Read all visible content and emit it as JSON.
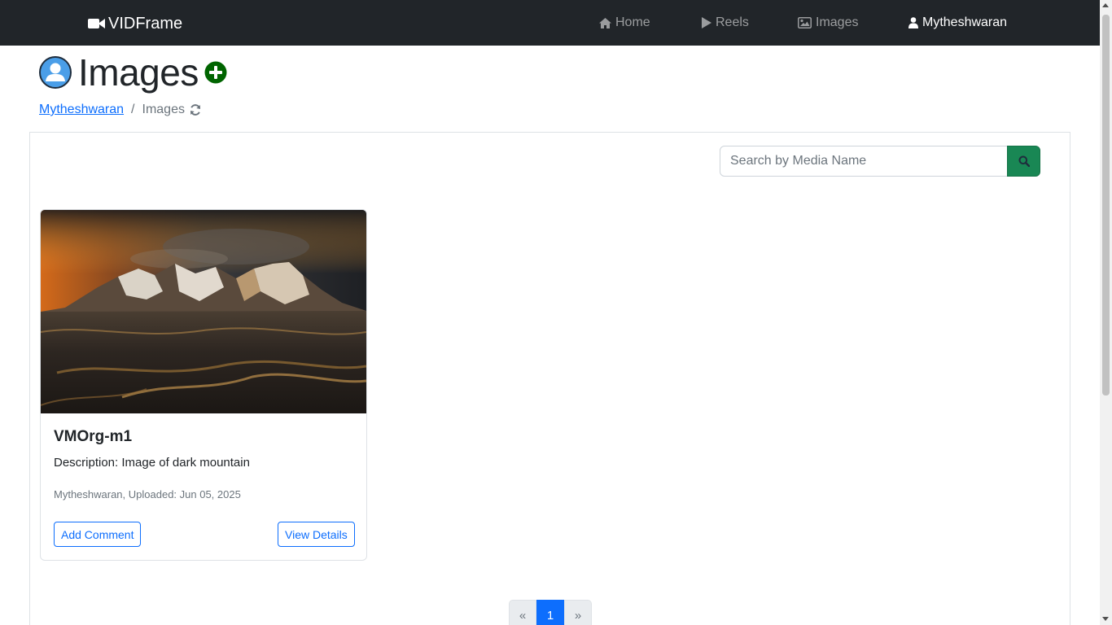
{
  "navbar": {
    "brand": "VIDFrame",
    "links": [
      {
        "label": "Home",
        "icon": "home-icon"
      },
      {
        "label": "Reels",
        "icon": "play-icon"
      },
      {
        "label": "Images",
        "icon": "image-icon"
      },
      {
        "label": "Mytheshwaran",
        "icon": "user-icon"
      }
    ],
    "bg_color": "#212529"
  },
  "header": {
    "title": "Images",
    "add_icon_color": "#006400"
  },
  "breadcrumb": {
    "user": "Mytheshwaran",
    "separator": "/",
    "current": "Images"
  },
  "search": {
    "placeholder": "Search by Media Name",
    "value": "",
    "button_color": "#198754"
  },
  "cards": [
    {
      "title": "VMOrg-m1",
      "description": "Description: Image of dark mountain",
      "meta": "Mytheshwaran, Uploaded: Jun 05, 2025",
      "add_comment_label": "Add Comment",
      "view_details_label": "View Details"
    }
  ],
  "pagination": {
    "prev": "«",
    "pages": [
      "1"
    ],
    "next": "»",
    "active_color": "#0d6efd"
  }
}
